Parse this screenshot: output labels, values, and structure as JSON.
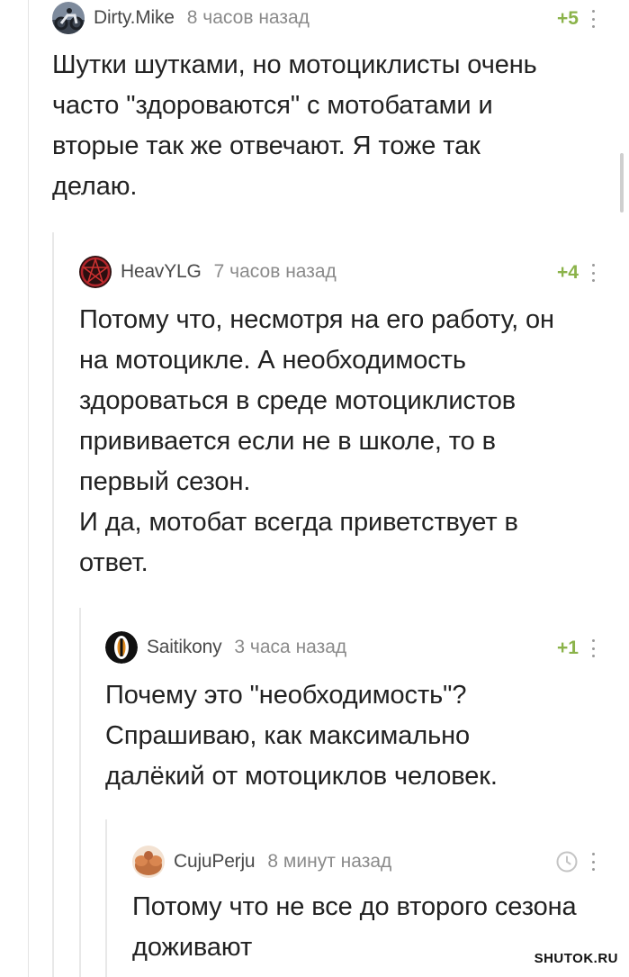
{
  "comments": [
    {
      "username": "Dirty.Mike",
      "time": "8 часов назад",
      "rating": "+5",
      "text": "Шутки шутками, но мотоциклисты очень\nчасто \"здороваются\" с мотобатами и\nвторые так же отвечают. Я тоже так\nделаю."
    },
    {
      "username": "HeavYLG",
      "time": "7 часов назад",
      "rating": "+4",
      "text": "Потому что, несмотря на его работу, он\nна мотоцикле. А необходимость\nздороваться в среде мотоциклистов\nпрививается если не в школе, то в\nпервый сезон.\nИ да, мотобат всегда приветствует в\nответ."
    },
    {
      "username": "Saitikony",
      "time": "3 часа назад",
      "rating": "+1",
      "text": "Почему это \"необходимость\"?\nСпрашиваю, как максимально\nдалёкий от мотоциклов человек."
    },
    {
      "username": "CujuPerju",
      "time": "8 минут назад",
      "rating": "",
      "rating_icon": "clock-icon",
      "text": "Потому что не все до второго сезона\nдоживают"
    }
  ],
  "watermark": "SHUTOK.RU",
  "colors": {
    "rating_green": "#8bb34a",
    "username_gray": "#4a4a4a",
    "time_gray": "#8a8a8a",
    "text": "#222222",
    "branch_line": "#e8e8e8"
  }
}
